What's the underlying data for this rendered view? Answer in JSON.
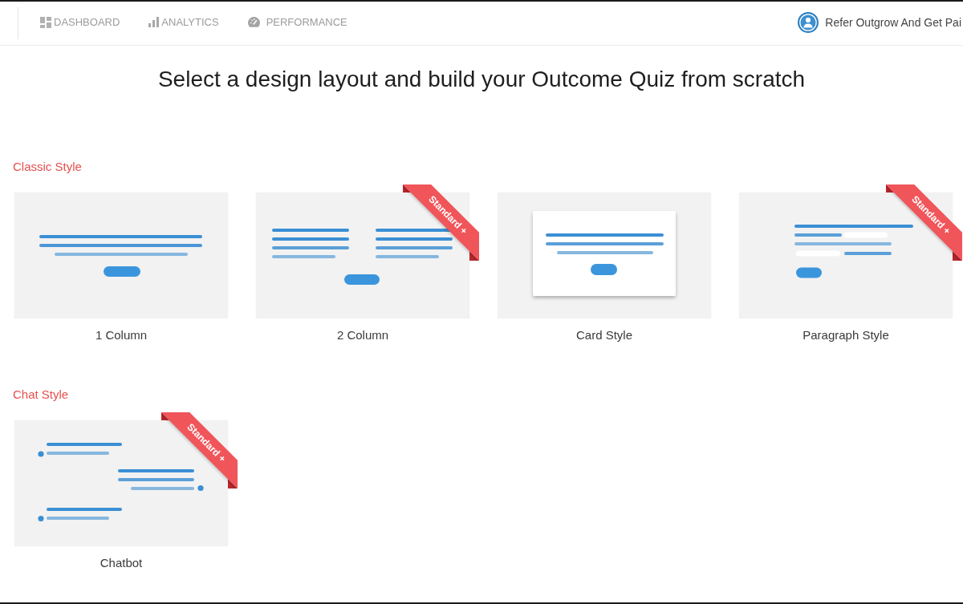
{
  "nav": {
    "items": [
      {
        "label": "DASHBOARD",
        "kind": "dashboard"
      },
      {
        "label": "ANALYTICS",
        "kind": "analytics"
      },
      {
        "label": "PERFORMANCE",
        "kind": "performance"
      }
    ],
    "referral": {
      "label": "Refer Outgrow And Get Pai"
    }
  },
  "heading": "Select a design layout and build your Outcome Quiz from scratch",
  "sections": [
    {
      "title": "Classic Style",
      "layouts": [
        {
          "name": "1 Column",
          "kind": "one-column"
        },
        {
          "name": "2 Column",
          "kind": "two-column",
          "ribbon": "Standard +"
        },
        {
          "name": "Card Style",
          "kind": "card"
        },
        {
          "name": "Paragraph Style",
          "kind": "paragraph",
          "ribbon": "Standard +"
        }
      ]
    },
    {
      "title": "Chat Style",
      "layouts": [
        {
          "name": "Chatbot",
          "kind": "chatbot",
          "ribbon": "Standard +"
        }
      ]
    }
  ]
}
